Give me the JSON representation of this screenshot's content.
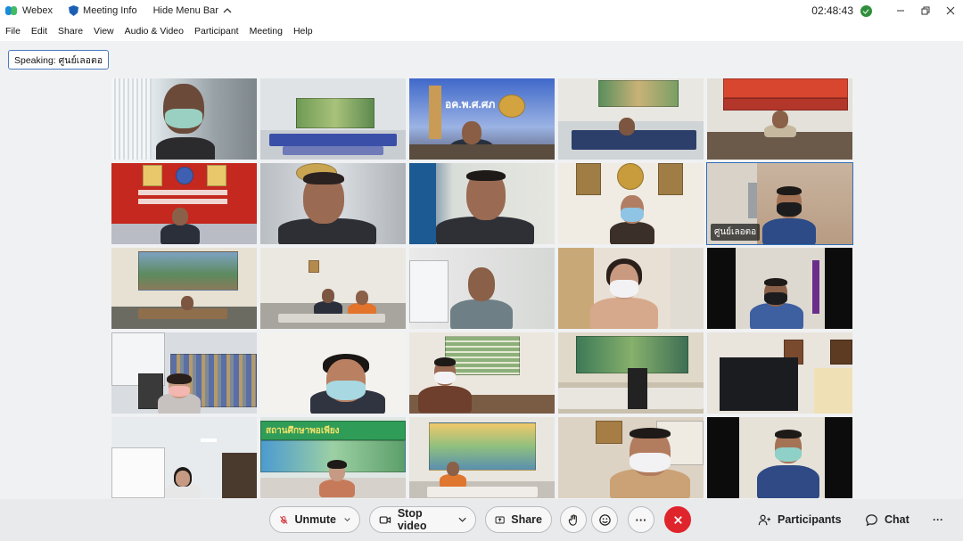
{
  "titlebar": {
    "app_name": "Webex",
    "meeting_info": "Meeting Info",
    "hide_menu_bar": "Hide Menu Bar",
    "clock": "02:48:43"
  },
  "menu": [
    "File",
    "Edit",
    "Share",
    "View",
    "Audio & Video",
    "Participant",
    "Meeting",
    "Help"
  ],
  "speaking": "Speaking: ศูนย์เลอตอ",
  "tiles": [
    {
      "id": 1,
      "label": ""
    },
    {
      "id": 2,
      "label": ""
    },
    {
      "id": 3,
      "label": ""
    },
    {
      "id": 4,
      "label": ""
    },
    {
      "id": 5,
      "label": ""
    },
    {
      "id": 6,
      "label": ""
    },
    {
      "id": 7,
      "label": ""
    },
    {
      "id": 8,
      "label": ""
    },
    {
      "id": 9,
      "label": ""
    },
    {
      "id": 10,
      "label": "ศูนย์เลอตอ",
      "active": true
    },
    {
      "id": 11,
      "label": ""
    },
    {
      "id": 12,
      "label": ""
    },
    {
      "id": 13,
      "label": ""
    },
    {
      "id": 14,
      "label": ""
    },
    {
      "id": 15,
      "label": ""
    },
    {
      "id": 16,
      "label": ""
    },
    {
      "id": 17,
      "label": ""
    },
    {
      "id": 18,
      "label": ""
    },
    {
      "id": 19,
      "label": ""
    },
    {
      "id": 20,
      "label": ""
    },
    {
      "id": 21,
      "label": ""
    },
    {
      "id": 22,
      "label": ""
    },
    {
      "id": 23,
      "label": ""
    },
    {
      "id": 24,
      "label": ""
    },
    {
      "id": 25,
      "label": ""
    }
  ],
  "toolbar": {
    "unmute": "Unmute",
    "stop_video": "Stop video",
    "share": "Share",
    "more": "···",
    "participants": "Participants",
    "chat": "Chat",
    "overflow": "···"
  },
  "colors": {
    "accent_blue": "#2f6fb8",
    "end_call_red": "#e0242c",
    "status_green": "#2f8f3b"
  }
}
